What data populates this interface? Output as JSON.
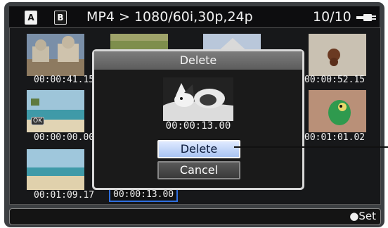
{
  "header": {
    "slot_a": "A",
    "slot_b": "B",
    "format": "MP4 > 1080/60i,30p,24p",
    "count": "10/10"
  },
  "thumbnails": [
    {
      "timecode": "00:00:41.15"
    },
    {
      "timecode": "00:00:52.15"
    },
    {
      "timecode": "00:00:00.00"
    },
    {
      "timecode": "00:01:01.02"
    },
    {
      "timecode": "00:01:09.17"
    },
    {
      "timecode": "00:00:13.00"
    }
  ],
  "ok_badge": "OK",
  "dialog": {
    "title": "Delete",
    "timecode": "00:00:13.00",
    "delete_label": "Delete",
    "cancel_label": "Cancel"
  },
  "footer": {
    "set_label": "●Set"
  },
  "colors": {
    "accent": "#2f6fe0",
    "dialog_title_bg": "#6b6b6b",
    "primary_button": "#c3d6f7"
  }
}
